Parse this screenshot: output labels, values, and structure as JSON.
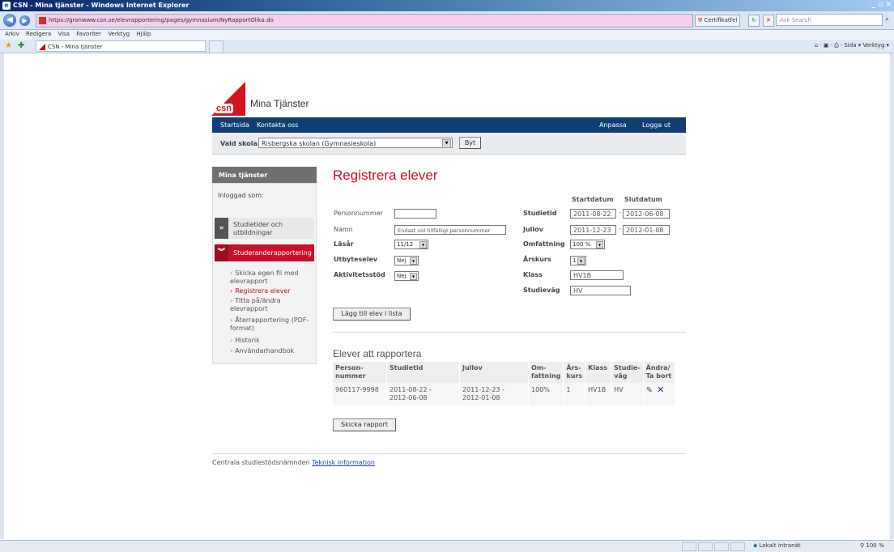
{
  "browser": {
    "title": "CSN - Mina tjänster - Windows Internet Explorer",
    "url": "https://gronwww.csn.se/elevrapportering/pages/gymnasium/NyRapportOlika.do",
    "cert_label": "Certifikatfel",
    "search_placeholder": "Ask Search",
    "menu": [
      "Arkiv",
      "Redigera",
      "Visa",
      "Favoriter",
      "Verktyg",
      "Hjälp"
    ],
    "tab_title": "CSN - Mina tjänster",
    "tools": "Sida ▾   Verktyg ▾",
    "status_zone": "Lokalt intranät",
    "status_zoom": "100 %"
  },
  "header": {
    "logo_text": "csn",
    "brand": "Mina Tjänster",
    "nav": [
      "Startsida",
      "Kontakta oss"
    ],
    "nav_right": [
      "Anpassa",
      "Logga ut"
    ]
  },
  "school": {
    "label": "Vald skola:",
    "selected": "Risbergska skolan (Gymnasieskola)",
    "change_button": "Byt"
  },
  "sidebar": {
    "title": "Mina tjänster",
    "logged_in": "Inloggad som:",
    "item1": "Studietider och utbildningar",
    "item2": "Studeranderapportering",
    "subitems": [
      "Skicka egen fil med elevrapport",
      "Registrera elever",
      "Titta på/ändra elevrapport",
      "Återrapportering (PDF-format)",
      "Historik",
      "Användarhandbok"
    ]
  },
  "form": {
    "title": "Registrera elever",
    "start_header": "Startdatum",
    "end_header": "Slutdatum",
    "personnummer_label": "Personnummer",
    "personnummer_value": "",
    "namn_label": "Namn",
    "namn_value": "Endast vid tillfälligt personnummer",
    "lasar_label": "Läsår",
    "lasar_value": "11/12",
    "utbyteselev_label": "Utbyteselev",
    "utbyteselev_value": "Nej",
    "aktivitetsstod_label": "Aktivitetsstöd",
    "aktivitetsstod_value": "Nej",
    "studietid_label": "Studietid",
    "studietid_start": "2011-08-22",
    "studietid_end": "2012-06-08",
    "jullov_label": "Jullov",
    "jullov_start": "2011-12-23",
    "jullov_end": "2012-01-08",
    "omfattning_label": "Omfattning",
    "omfattning_value": "100 %",
    "arskurs_label": "Årskurs",
    "arskurs_value": "1",
    "klass_label": "Klass",
    "klass_value": "HV1B",
    "studievag_label": "Studieväg",
    "studievag_value": "HV",
    "add_button": "Lägg till elev i lista"
  },
  "list": {
    "title": "Elever att rapportera",
    "headers": [
      "Person-\nnummer",
      "Studietid",
      "Jullov",
      "Om-\nfattning",
      "Års-\nkurs",
      "Klass",
      "Studie-\nväg",
      "Ändra/\nTa bort"
    ],
    "rows": [
      {
        "personnummer": "960117-9998",
        "studietid": "2011-08-22 -\n2012-06-08",
        "jullov": "2011-12-23 -\n2012-01-08",
        "omfattning": "100%",
        "arskurs": "1",
        "klass": "HV1B",
        "studievag": "HV"
      }
    ],
    "send_button": "Skicka rapport"
  },
  "footer": {
    "text": "Centrala studiestödsnämnden",
    "link": "Teknisk information"
  }
}
